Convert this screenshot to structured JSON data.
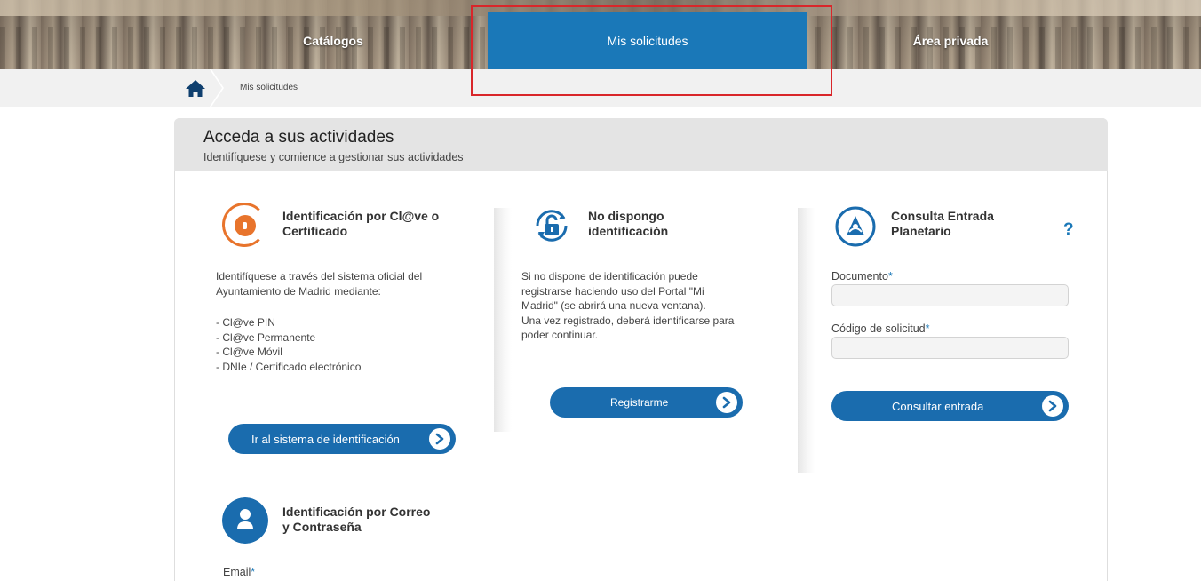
{
  "nav": {
    "tabs": [
      {
        "label": "Catálogos"
      },
      {
        "label": "Mis solicitudes"
      },
      {
        "label": "Área privada"
      }
    ]
  },
  "breadcrumb": {
    "current": "Mis solicitudes"
  },
  "card": {
    "title": "Acceda a sus actividades",
    "subtitle": "Identifíquese y comience a gestionar sus actividades"
  },
  "clave": {
    "title_line1": "Identificación por Cl@ve o",
    "title_line2": "Certificado",
    "desc_line1": "Identifíquese a través del sistema oficial del",
    "desc_line2": "Ayuntamiento de Madrid mediante:",
    "options": [
      "- Cl@ve PIN",
      "- Cl@ve Permanente",
      "- Cl@ve Móvil",
      "- DNIe / Certificado electrónico"
    ],
    "button": "Ir al sistema de identificación"
  },
  "correo": {
    "title_line1": "Identificación por Correo",
    "title_line2": "y Contraseña",
    "email_label": "Email",
    "required_mark": "*"
  },
  "register": {
    "title_line1": "No dispongo",
    "title_line2": "identificación",
    "desc_lines": [
      "Si no dispone de identificación puede",
      "registrarse haciendo uso del Portal \"Mi",
      "Madrid\" (se abrirá una nueva ventana).",
      "Una vez registrado, deberá identificarse para",
      "poder continuar."
    ],
    "button": "Registrarme"
  },
  "planetario": {
    "title_line1": "Consulta Entrada",
    "title_line2": "Planetario",
    "help": "?",
    "documento_label": "Documento",
    "codigo_label": "Código de solicitud",
    "required_mark": "*",
    "button": "Consultar entrada"
  },
  "colors": {
    "accent": "#1a78b8",
    "button": "#1a6cae",
    "clave_orange": "#e8742c",
    "highlight": "#d9262a"
  }
}
